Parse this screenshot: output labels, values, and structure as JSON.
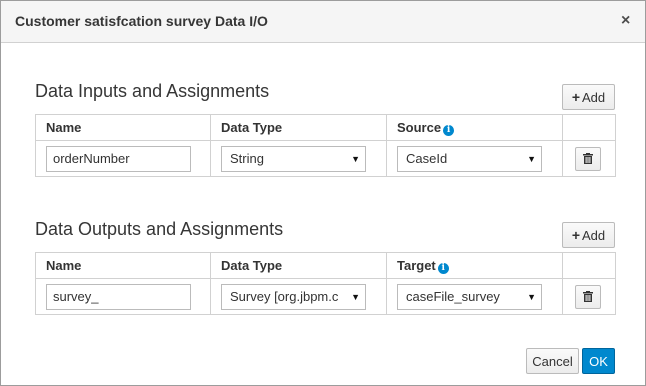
{
  "dialog": {
    "title": "Customer satisfcation survey Data I/O",
    "close_glyph": "×"
  },
  "inputs": {
    "section_title": "Data Inputs and Assignments",
    "add_label": "Add",
    "columns": {
      "name": "Name",
      "data_type": "Data Type",
      "source": "Source"
    },
    "rows": [
      {
        "name": "orderNumber",
        "data_type": "String",
        "source": "CaseId"
      }
    ]
  },
  "outputs": {
    "section_title": "Data Outputs and Assignments",
    "add_label": "Add",
    "columns": {
      "name": "Name",
      "data_type": "Data Type",
      "target": "Target"
    },
    "rows": [
      {
        "name": "survey_",
        "data_type": "Survey [org.jbpm.c",
        "target": "caseFile_survey"
      }
    ]
  },
  "footer": {
    "cancel_label": "Cancel",
    "ok_label": "OK"
  },
  "icons": {
    "plus": "plus-icon",
    "info": "info-circle-icon",
    "trash": "trash-icon",
    "close": "close-icon",
    "dropdown": "caret-down-icon"
  },
  "colors": {
    "primary": "#0088ce",
    "header_bg": "#f5f5f5",
    "border": "#d1d1d1"
  }
}
